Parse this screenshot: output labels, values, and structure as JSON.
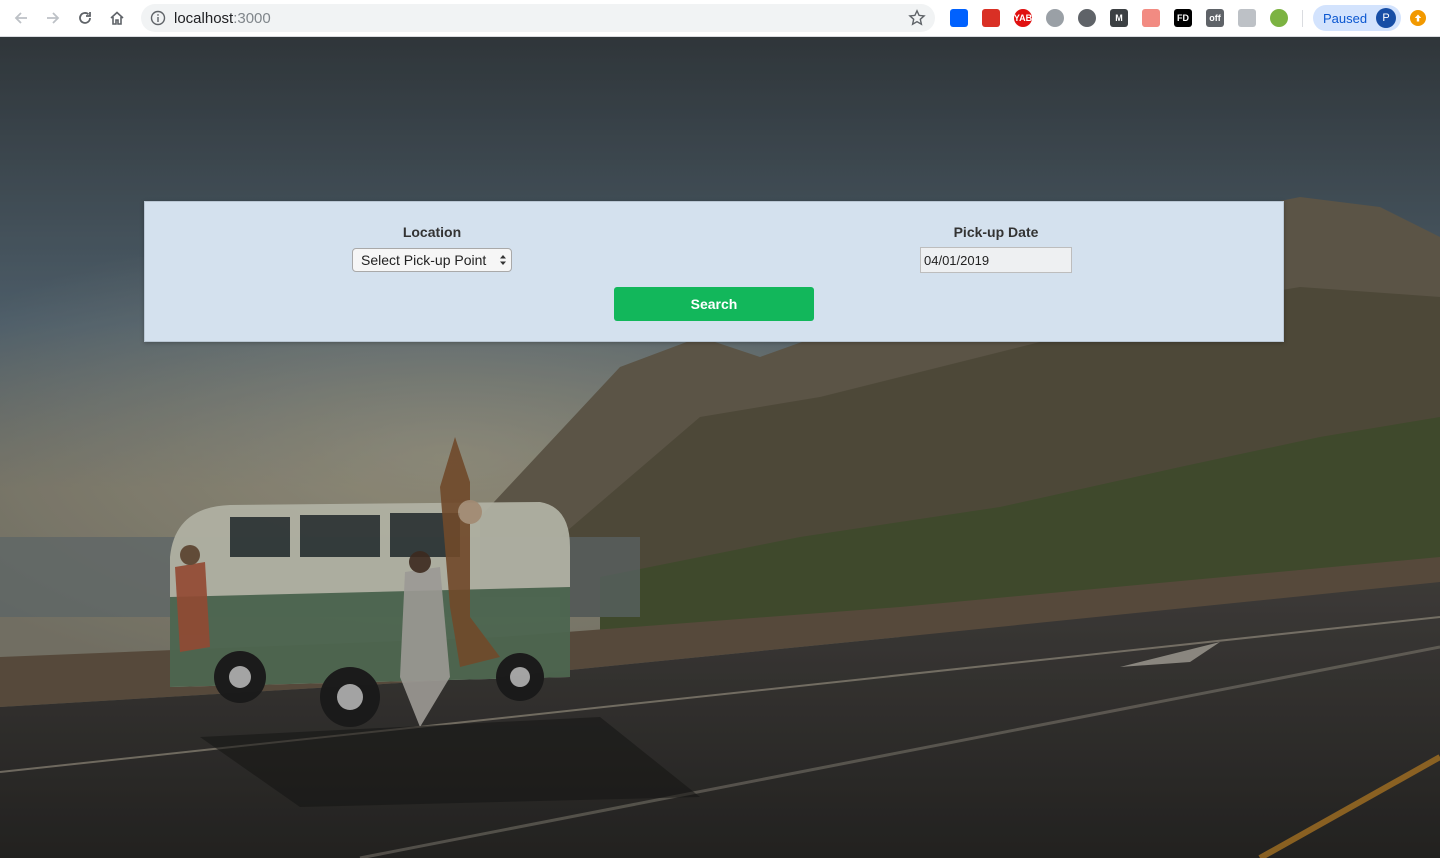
{
  "browser": {
    "url_host": "localhost",
    "url_port": ":3000",
    "extensions": [
      {
        "name": "dropbox-icon",
        "color": "#0061fe",
        "text": ""
      },
      {
        "name": "extension-red-icon",
        "color": "#d93025",
        "text": ""
      },
      {
        "name": "yab-icon",
        "color": "#e01010",
        "text": "YAB"
      },
      {
        "name": "globe-icon",
        "color": "#9aa0a6",
        "text": ""
      },
      {
        "name": "code-braces-icon",
        "color": "#5f6368",
        "text": ""
      },
      {
        "name": "m-icon",
        "color": "#3c4043",
        "text": "M"
      },
      {
        "name": "send-arrow-icon",
        "color": "#f28b82",
        "text": ""
      },
      {
        "name": "fd-icon",
        "color": "#000000",
        "text": "FD"
      },
      {
        "name": "off-badge-icon",
        "color": "#5f6368",
        "text": "off"
      },
      {
        "name": "chat-bubble-icon",
        "color": "#bdc1c6",
        "text": ""
      },
      {
        "name": "green-leaf-icon",
        "color": "#7cb342",
        "text": ""
      }
    ],
    "profile_label": "Paused",
    "profile_initial": "P"
  },
  "search_form": {
    "location_label": "Location",
    "location_select_value": "Select Pick-up Point",
    "pickup_date_label": "Pick-up Date",
    "pickup_date_value": "04/01/2019",
    "search_button_label": "Search"
  },
  "colors": {
    "panel_bg": "#d4e1ee",
    "search_button": "#12b75b"
  }
}
